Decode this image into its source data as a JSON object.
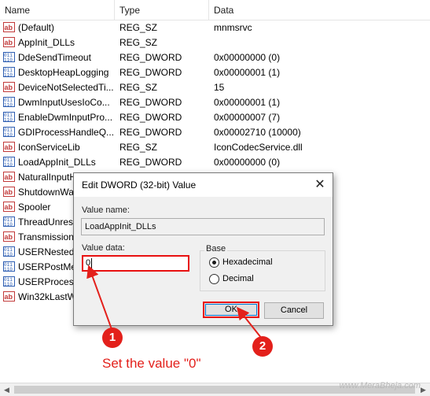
{
  "columns": {
    "name": "Name",
    "type": "Type",
    "data": "Data"
  },
  "rows": [
    {
      "name": "(Default)",
      "type": "REG_SZ",
      "data": "mnmsrvc",
      "icon": "string-value-icon"
    },
    {
      "name": "AppInit_DLLs",
      "type": "REG_SZ",
      "data": "",
      "icon": "string-value-icon"
    },
    {
      "name": "DdeSendTimeout",
      "type": "REG_DWORD",
      "data": "0x00000000 (0)",
      "icon": "binary-value-icon"
    },
    {
      "name": "DesktopHeapLogging",
      "type": "REG_DWORD",
      "data": "0x00000001 (1)",
      "icon": "binary-value-icon"
    },
    {
      "name": "DeviceNotSelectedTi...",
      "type": "REG_SZ",
      "data": "15",
      "icon": "string-value-icon"
    },
    {
      "name": "DwmInputUsesIoCo...",
      "type": "REG_DWORD",
      "data": "0x00000001 (1)",
      "icon": "binary-value-icon"
    },
    {
      "name": "EnableDwmInputPro...",
      "type": "REG_DWORD",
      "data": "0x00000007 (7)",
      "icon": "binary-value-icon"
    },
    {
      "name": "GDIProcessHandleQ...",
      "type": "REG_DWORD",
      "data": "0x00002710 (10000)",
      "icon": "binary-value-icon"
    },
    {
      "name": "IconServiceLib",
      "type": "REG_SZ",
      "data": "IconCodecService.dll",
      "icon": "string-value-icon"
    },
    {
      "name": "LoadAppInit_DLLs",
      "type": "REG_DWORD",
      "data": "0x00000000 (0)",
      "icon": "binary-value-icon"
    },
    {
      "name": "NaturalInputH",
      "type": "",
      "data": "",
      "icon": "string-value-icon"
    },
    {
      "name": "ShutdownWa",
      "type": "",
      "data": "",
      "icon": "string-value-icon"
    },
    {
      "name": "Spooler",
      "type": "",
      "data": "",
      "icon": "string-value-icon"
    },
    {
      "name": "ThreadUnresp",
      "type": "",
      "data": "",
      "icon": "binary-value-icon"
    },
    {
      "name": "TransmissionI",
      "type": "",
      "data": "",
      "icon": "string-value-icon"
    },
    {
      "name": "USERNestedW",
      "type": "",
      "data": "",
      "icon": "binary-value-icon"
    },
    {
      "name": "USERPostMes",
      "type": "",
      "data": "",
      "icon": "binary-value-icon"
    },
    {
      "name": "USERProcessH",
      "type": "",
      "data": "",
      "icon": "binary-value-icon"
    },
    {
      "name": "Win32kLastW",
      "type": "",
      "data": "",
      "icon": "string-value-icon"
    }
  ],
  "dialog": {
    "title": "Edit DWORD (32-bit) Value",
    "value_name_label": "Value name:",
    "value_name": "LoadAppInit_DLLs",
    "value_data_label": "Value data:",
    "value_data": "0",
    "base_label": "Base",
    "radio_hex": "Hexadecimal",
    "radio_dec": "Decimal",
    "ok_label": "OK",
    "cancel_label": "Cancel",
    "close_glyph": "✕"
  },
  "annotations": {
    "badge1": "1",
    "badge2": "2",
    "instruction": "Set the value \"0\"",
    "color": "#e3201b"
  },
  "watermark": "www.MeraBheja.com"
}
